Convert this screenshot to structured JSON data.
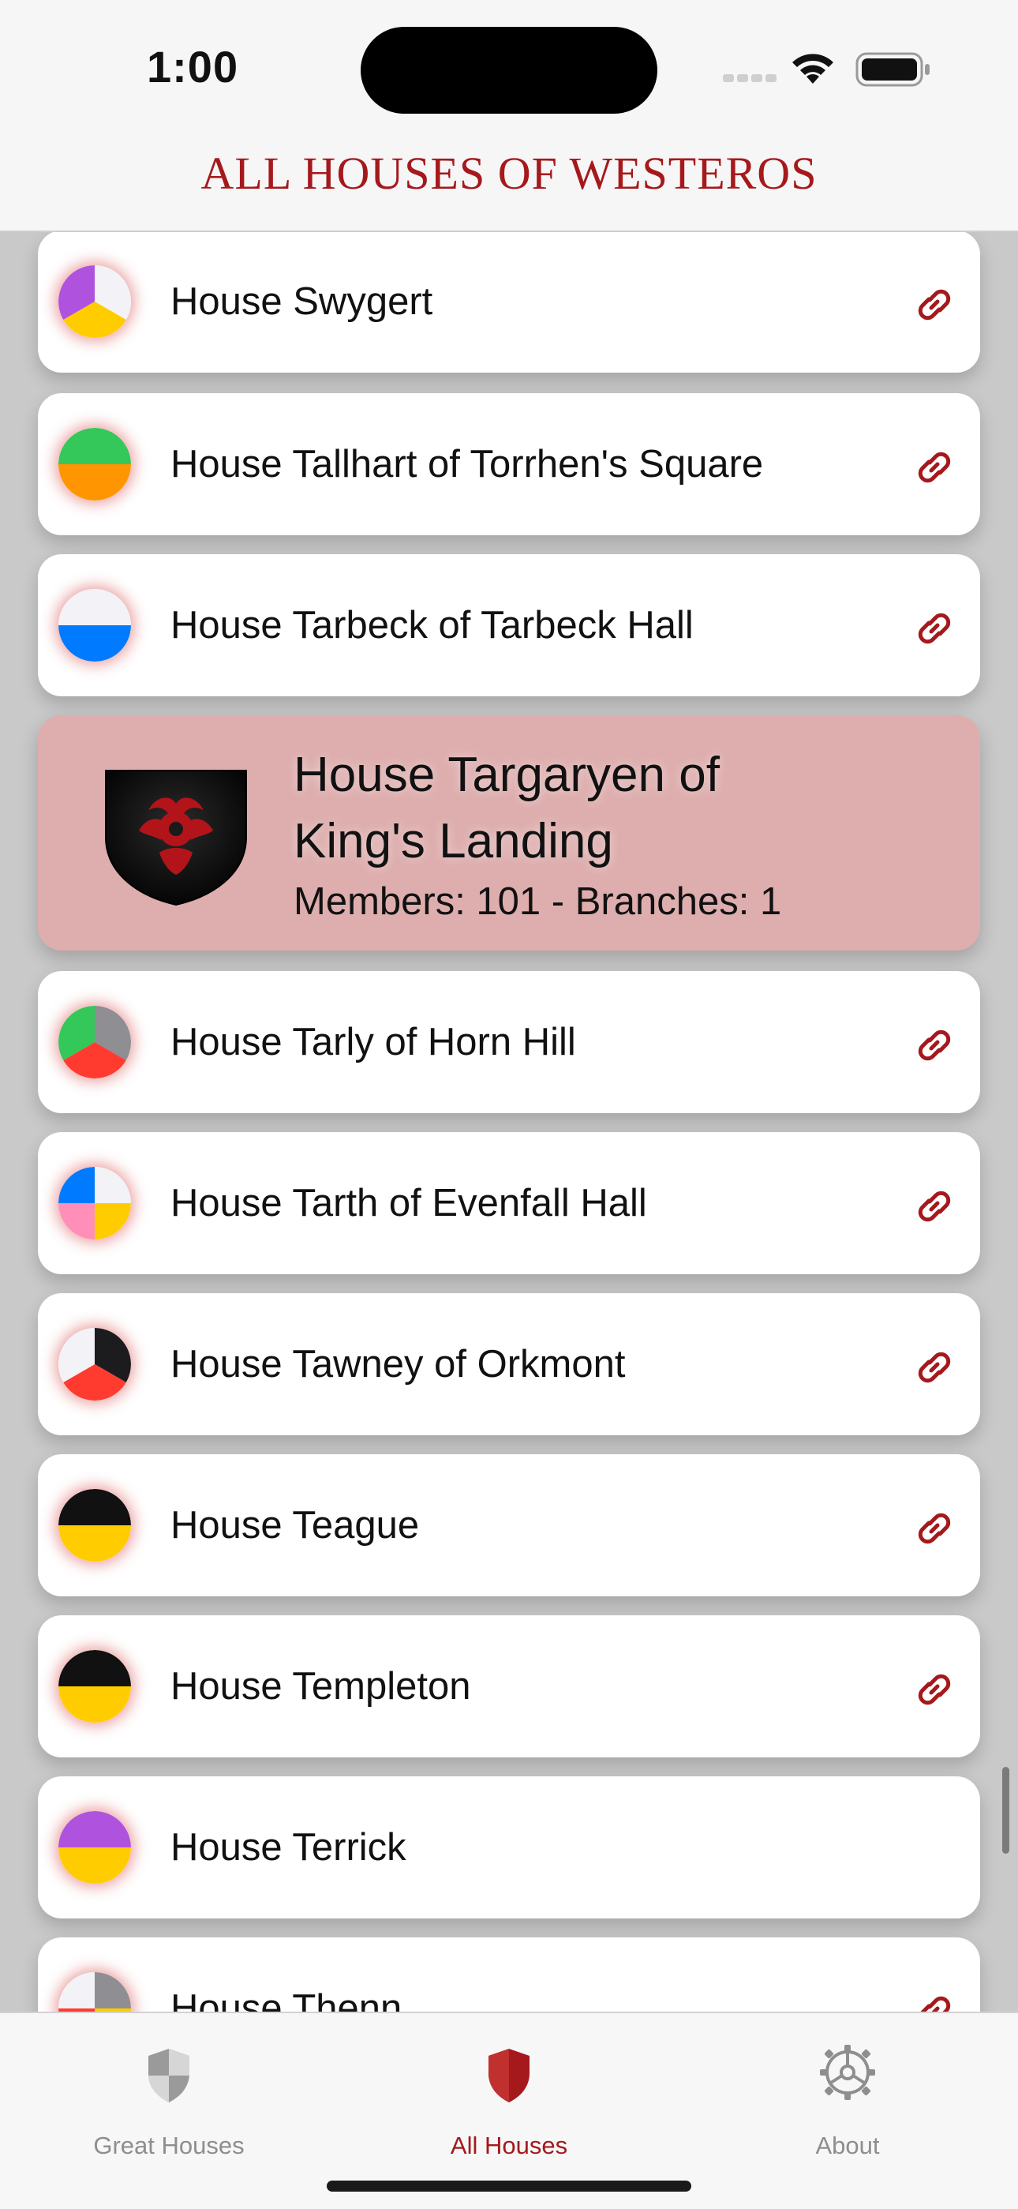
{
  "status_bar": {
    "time": "1:00"
  },
  "nav": {
    "title": "All Houses of Westeros"
  },
  "houses": [
    {
      "name": "House Swygert",
      "colors": [
        "#f2f2f7",
        "#ffcc00",
        "#af52de"
      ],
      "has_link": true
    },
    {
      "name": "House Tallhart of Torrhen's Square",
      "colors": [
        "#34c759",
        "#ff9500"
      ],
      "has_link": true
    },
    {
      "name": "House Tarbeck of Tarbeck Hall",
      "colors": [
        "#f2f2f7",
        "#007aff"
      ],
      "has_link": true
    }
  ],
  "featured": {
    "name": "House Targaryen of King's Landing",
    "meta": "Members: 101 - Branches: 1",
    "icon": "targaryen-dragon-sigil"
  },
  "houses_after": [
    {
      "name": "House Tarly of Horn Hill",
      "colors": [
        "#8e8e93",
        "#ff3b30",
        "#34c759"
      ],
      "has_link": true
    },
    {
      "name": "House Tarth of Evenfall Hall",
      "colors": [
        "#f2f2f7",
        "#ffcc00",
        "#ff8fb8",
        "#007aff"
      ],
      "has_link": true
    },
    {
      "name": "House Tawney of Orkmont",
      "colors": [
        "#1c1c1e",
        "#ff3b30",
        "#f2f2f7"
      ],
      "has_link": true
    },
    {
      "name": "House Teague",
      "colors": [
        "#111111",
        "#ffcc00"
      ],
      "has_link": true
    },
    {
      "name": "House Templeton",
      "colors": [
        "#111111",
        "#ffcc00"
      ],
      "has_link": true
    },
    {
      "name": "House Terrick",
      "colors": [
        "#af52de",
        "#ffcc00"
      ],
      "has_link": false
    },
    {
      "name": "House Thenn",
      "colors": [
        "#8e8e93",
        "#ffcc00",
        "#ff3b30",
        "#f2f2f7"
      ],
      "has_link": true
    }
  ],
  "tabs": [
    {
      "label": "Great Houses",
      "icon": "shield-checkered-icon",
      "active": false
    },
    {
      "label": "All Houses",
      "icon": "shield-icon",
      "active": true
    },
    {
      "label": "About",
      "icon": "gear-icon",
      "active": false
    }
  ],
  "theme": {
    "accent": "#a5191c",
    "featured_bg": "#deaeae"
  }
}
